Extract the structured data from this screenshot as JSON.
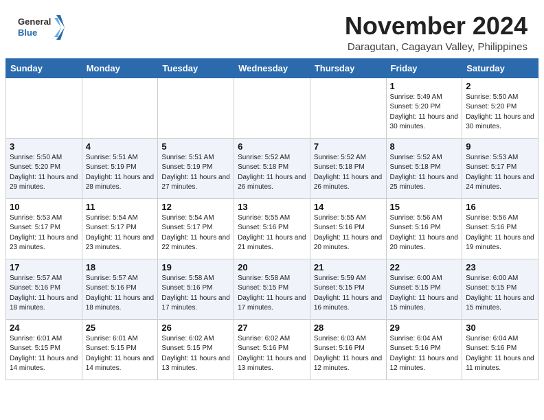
{
  "header": {
    "logo_general": "General",
    "logo_blue": "Blue",
    "month_title": "November 2024",
    "location": "Daragutan, Cagayan Valley, Philippines"
  },
  "weekdays": [
    "Sunday",
    "Monday",
    "Tuesday",
    "Wednesday",
    "Thursday",
    "Friday",
    "Saturday"
  ],
  "weeks": [
    [
      {
        "day": "",
        "sunrise": "",
        "sunset": "",
        "daylight": ""
      },
      {
        "day": "",
        "sunrise": "",
        "sunset": "",
        "daylight": ""
      },
      {
        "day": "",
        "sunrise": "",
        "sunset": "",
        "daylight": ""
      },
      {
        "day": "",
        "sunrise": "",
        "sunset": "",
        "daylight": ""
      },
      {
        "day": "",
        "sunrise": "",
        "sunset": "",
        "daylight": ""
      },
      {
        "day": "1",
        "sunrise": "Sunrise: 5:49 AM",
        "sunset": "Sunset: 5:20 PM",
        "daylight": "Daylight: 11 hours and 30 minutes."
      },
      {
        "day": "2",
        "sunrise": "Sunrise: 5:50 AM",
        "sunset": "Sunset: 5:20 PM",
        "daylight": "Daylight: 11 hours and 30 minutes."
      }
    ],
    [
      {
        "day": "3",
        "sunrise": "Sunrise: 5:50 AM",
        "sunset": "Sunset: 5:20 PM",
        "daylight": "Daylight: 11 hours and 29 minutes."
      },
      {
        "day": "4",
        "sunrise": "Sunrise: 5:51 AM",
        "sunset": "Sunset: 5:19 PM",
        "daylight": "Daylight: 11 hours and 28 minutes."
      },
      {
        "day": "5",
        "sunrise": "Sunrise: 5:51 AM",
        "sunset": "Sunset: 5:19 PM",
        "daylight": "Daylight: 11 hours and 27 minutes."
      },
      {
        "day": "6",
        "sunrise": "Sunrise: 5:52 AM",
        "sunset": "Sunset: 5:18 PM",
        "daylight": "Daylight: 11 hours and 26 minutes."
      },
      {
        "day": "7",
        "sunrise": "Sunrise: 5:52 AM",
        "sunset": "Sunset: 5:18 PM",
        "daylight": "Daylight: 11 hours and 26 minutes."
      },
      {
        "day": "8",
        "sunrise": "Sunrise: 5:52 AM",
        "sunset": "Sunset: 5:18 PM",
        "daylight": "Daylight: 11 hours and 25 minutes."
      },
      {
        "day": "9",
        "sunrise": "Sunrise: 5:53 AM",
        "sunset": "Sunset: 5:17 PM",
        "daylight": "Daylight: 11 hours and 24 minutes."
      }
    ],
    [
      {
        "day": "10",
        "sunrise": "Sunrise: 5:53 AM",
        "sunset": "Sunset: 5:17 PM",
        "daylight": "Daylight: 11 hours and 23 minutes."
      },
      {
        "day": "11",
        "sunrise": "Sunrise: 5:54 AM",
        "sunset": "Sunset: 5:17 PM",
        "daylight": "Daylight: 11 hours and 23 minutes."
      },
      {
        "day": "12",
        "sunrise": "Sunrise: 5:54 AM",
        "sunset": "Sunset: 5:17 PM",
        "daylight": "Daylight: 11 hours and 22 minutes."
      },
      {
        "day": "13",
        "sunrise": "Sunrise: 5:55 AM",
        "sunset": "Sunset: 5:16 PM",
        "daylight": "Daylight: 11 hours and 21 minutes."
      },
      {
        "day": "14",
        "sunrise": "Sunrise: 5:55 AM",
        "sunset": "Sunset: 5:16 PM",
        "daylight": "Daylight: 11 hours and 20 minutes."
      },
      {
        "day": "15",
        "sunrise": "Sunrise: 5:56 AM",
        "sunset": "Sunset: 5:16 PM",
        "daylight": "Daylight: 11 hours and 20 minutes."
      },
      {
        "day": "16",
        "sunrise": "Sunrise: 5:56 AM",
        "sunset": "Sunset: 5:16 PM",
        "daylight": "Daylight: 11 hours and 19 minutes."
      }
    ],
    [
      {
        "day": "17",
        "sunrise": "Sunrise: 5:57 AM",
        "sunset": "Sunset: 5:16 PM",
        "daylight": "Daylight: 11 hours and 18 minutes."
      },
      {
        "day": "18",
        "sunrise": "Sunrise: 5:57 AM",
        "sunset": "Sunset: 5:16 PM",
        "daylight": "Daylight: 11 hours and 18 minutes."
      },
      {
        "day": "19",
        "sunrise": "Sunrise: 5:58 AM",
        "sunset": "Sunset: 5:16 PM",
        "daylight": "Daylight: 11 hours and 17 minutes."
      },
      {
        "day": "20",
        "sunrise": "Sunrise: 5:58 AM",
        "sunset": "Sunset: 5:15 PM",
        "daylight": "Daylight: 11 hours and 17 minutes."
      },
      {
        "day": "21",
        "sunrise": "Sunrise: 5:59 AM",
        "sunset": "Sunset: 5:15 PM",
        "daylight": "Daylight: 11 hours and 16 minutes."
      },
      {
        "day": "22",
        "sunrise": "Sunrise: 6:00 AM",
        "sunset": "Sunset: 5:15 PM",
        "daylight": "Daylight: 11 hours and 15 minutes."
      },
      {
        "day": "23",
        "sunrise": "Sunrise: 6:00 AM",
        "sunset": "Sunset: 5:15 PM",
        "daylight": "Daylight: 11 hours and 15 minutes."
      }
    ],
    [
      {
        "day": "24",
        "sunrise": "Sunrise: 6:01 AM",
        "sunset": "Sunset: 5:15 PM",
        "daylight": "Daylight: 11 hours and 14 minutes."
      },
      {
        "day": "25",
        "sunrise": "Sunrise: 6:01 AM",
        "sunset": "Sunset: 5:15 PM",
        "daylight": "Daylight: 11 hours and 14 minutes."
      },
      {
        "day": "26",
        "sunrise": "Sunrise: 6:02 AM",
        "sunset": "Sunset: 5:15 PM",
        "daylight": "Daylight: 11 hours and 13 minutes."
      },
      {
        "day": "27",
        "sunrise": "Sunrise: 6:02 AM",
        "sunset": "Sunset: 5:16 PM",
        "daylight": "Daylight: 11 hours and 13 minutes."
      },
      {
        "day": "28",
        "sunrise": "Sunrise: 6:03 AM",
        "sunset": "Sunset: 5:16 PM",
        "daylight": "Daylight: 11 hours and 12 minutes."
      },
      {
        "day": "29",
        "sunrise": "Sunrise: 6:04 AM",
        "sunset": "Sunset: 5:16 PM",
        "daylight": "Daylight: 11 hours and 12 minutes."
      },
      {
        "day": "30",
        "sunrise": "Sunrise: 6:04 AM",
        "sunset": "Sunset: 5:16 PM",
        "daylight": "Daylight: 11 hours and 11 minutes."
      }
    ]
  ]
}
